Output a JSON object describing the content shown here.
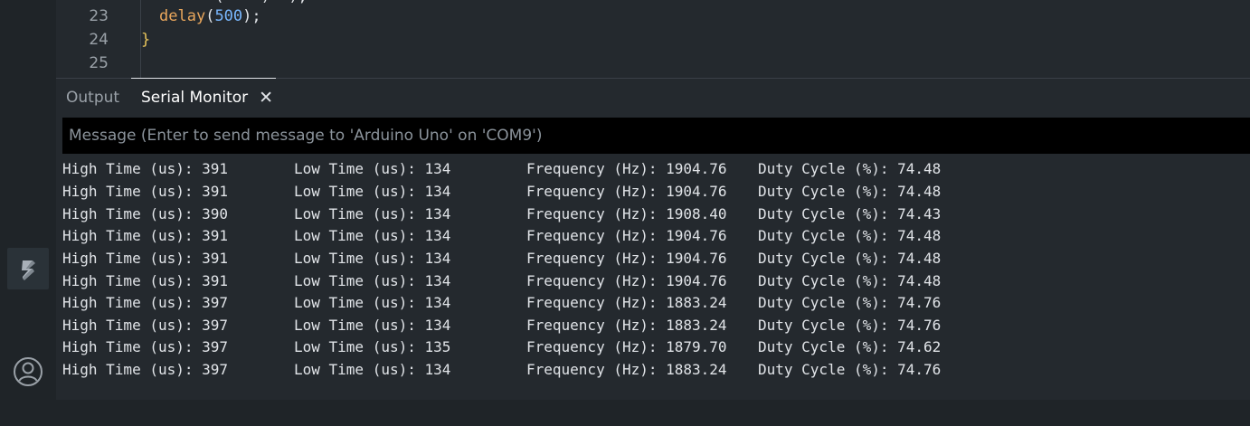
{
  "editor": {
    "lines": [
      {
        "number": "23",
        "fn": "delay",
        "open": "(",
        "arg": "500",
        "close": ");"
      },
      {
        "number": "24",
        "brace": "}"
      },
      {
        "number": "25"
      }
    ]
  },
  "panel": {
    "tabs": [
      {
        "label": "Output"
      },
      {
        "label": "Serial Monitor",
        "close": "✕"
      }
    ],
    "message_placeholder": "Message (Enter to send message to 'Arduino Uno' on 'COM9')",
    "rows": [
      {
        "high": "High Time (us): 391",
        "low": "Low Time (us): 134",
        "freq": "Frequency (Hz): 1904.76",
        "duty": "Duty Cycle (%): 74.48"
      },
      {
        "high": "High Time (us): 391",
        "low": "Low Time (us): 134",
        "freq": "Frequency (Hz): 1904.76",
        "duty": "Duty Cycle (%): 74.48"
      },
      {
        "high": "High Time (us): 390",
        "low": "Low Time (us): 134",
        "freq": "Frequency (Hz): 1908.40",
        "duty": "Duty Cycle (%): 74.43"
      },
      {
        "high": "High Time (us): 391",
        "low": "Low Time (us): 134",
        "freq": "Frequency (Hz): 1904.76",
        "duty": "Duty Cycle (%): 74.48"
      },
      {
        "high": "High Time (us): 391",
        "low": "Low Time (us): 134",
        "freq": "Frequency (Hz): 1904.76",
        "duty": "Duty Cycle (%): 74.48"
      },
      {
        "high": "High Time (us): 391",
        "low": "Low Time (us): 134",
        "freq": "Frequency (Hz): 1904.76",
        "duty": "Duty Cycle (%): 74.48"
      },
      {
        "high": "High Time (us): 397",
        "low": "Low Time (us): 134",
        "freq": "Frequency (Hz): 1883.24",
        "duty": "Duty Cycle (%): 74.76"
      },
      {
        "high": "High Time (us): 397",
        "low": "Low Time (us): 134",
        "freq": "Frequency (Hz): 1883.24",
        "duty": "Duty Cycle (%): 74.76"
      },
      {
        "high": "High Time (us): 397",
        "low": "Low Time (us): 135",
        "freq": "Frequency (Hz): 1879.70",
        "duty": "Duty Cycle (%): 74.62"
      },
      {
        "high": "High Time (us): 397",
        "low": "Low Time (us): 134",
        "freq": "Frequency (Hz): 1883.24",
        "duty": "Duty Cycle (%): 74.76"
      }
    ]
  },
  "activity_bar": {
    "icons": [
      "sketchbook-icon",
      "account-icon"
    ]
  },
  "colors": {
    "background": "#24292e",
    "activity_bar": "#1f2428",
    "function": "#e8a65c",
    "number": "#79b8ff",
    "brace": "#e8c55c"
  }
}
